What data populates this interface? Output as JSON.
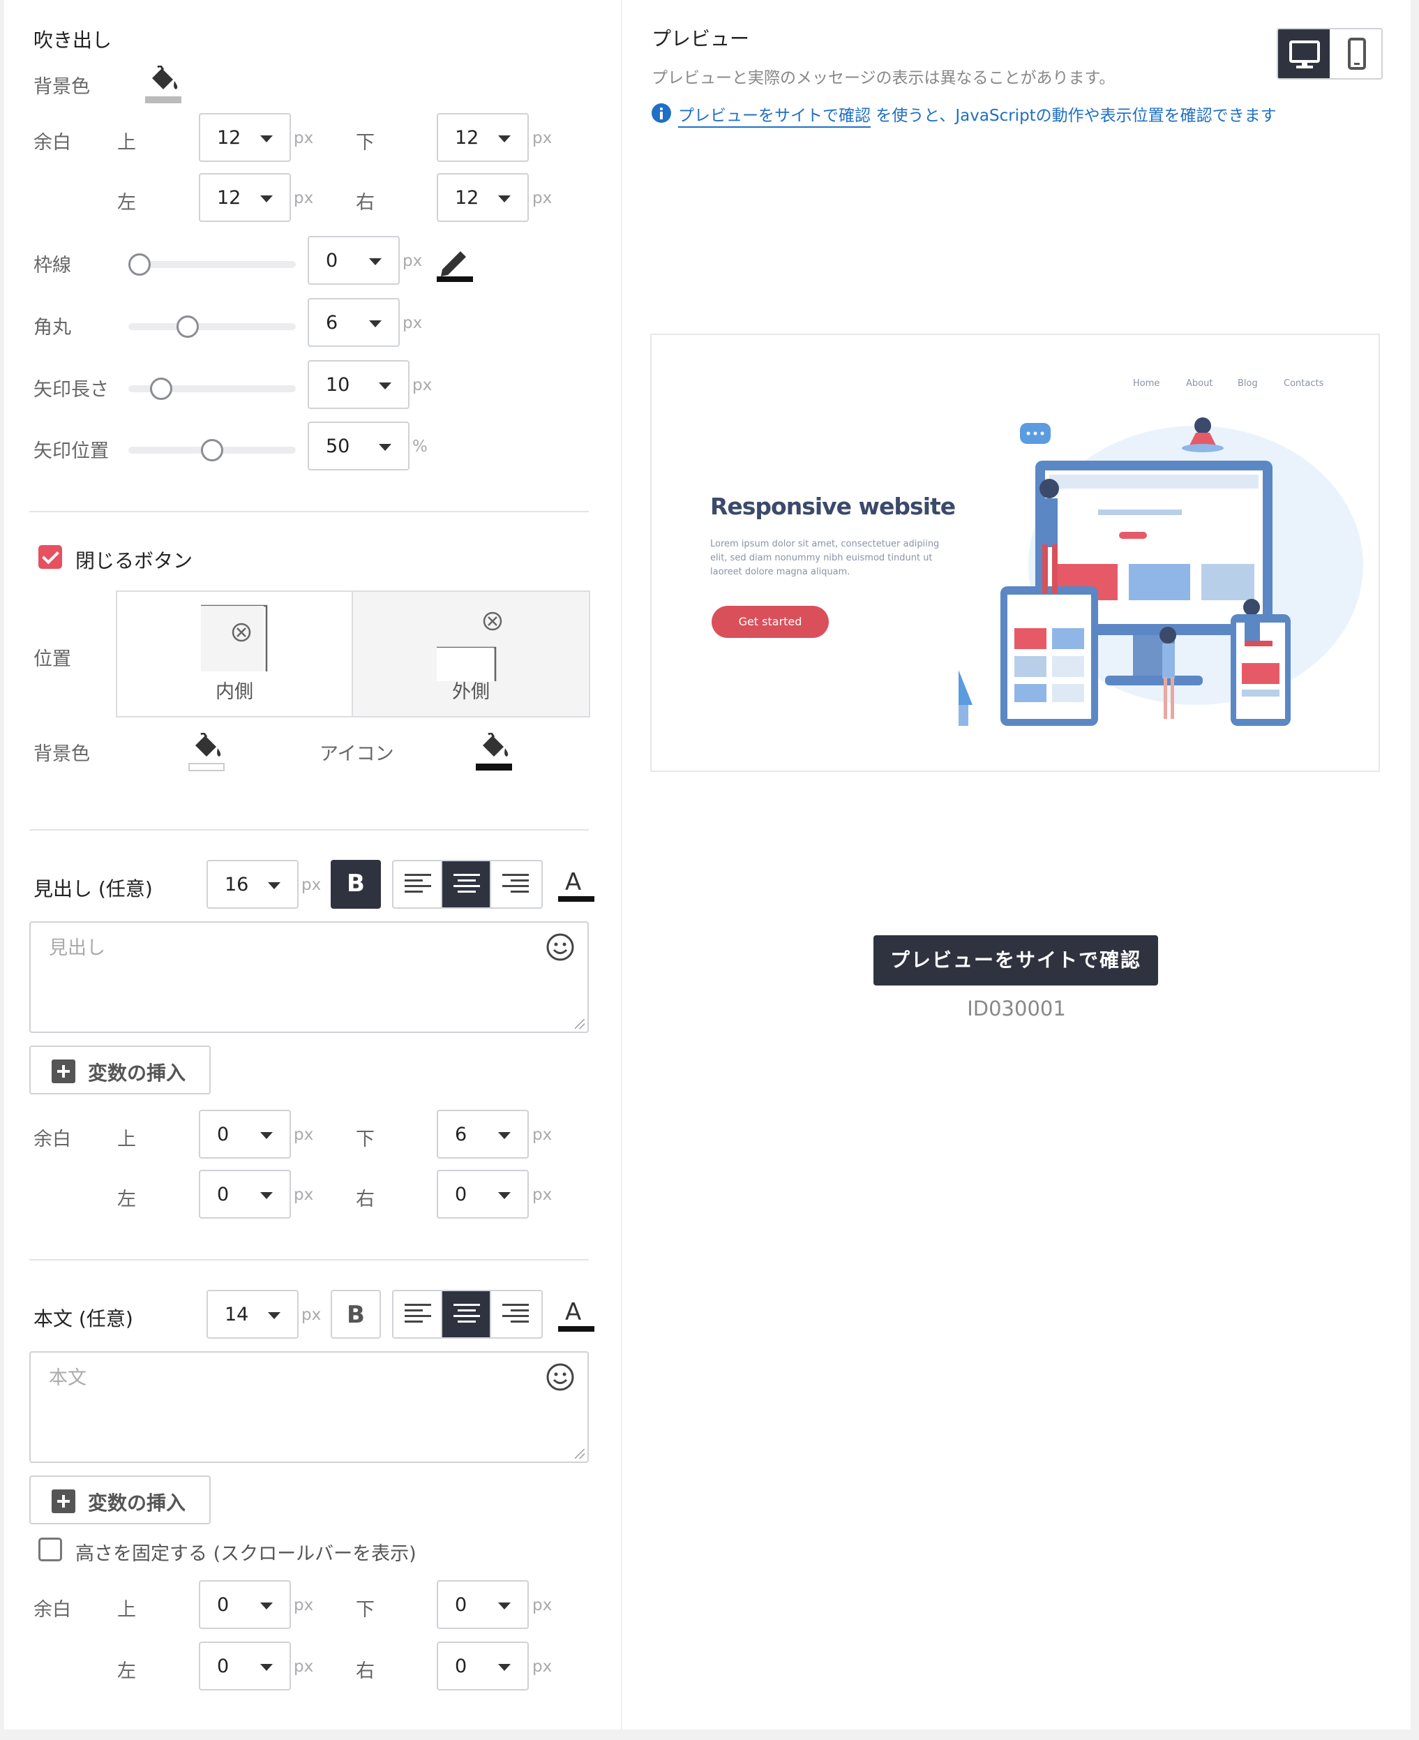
{
  "left": {
    "balloon": {
      "title": "吹き出し",
      "bg_label": "背景色",
      "padding": {
        "label": "余白",
        "top_label": "上",
        "bottom_label": "下",
        "left_label": "左",
        "right_label": "右",
        "top": "12",
        "bottom": "12",
        "left": "12",
        "right": "12",
        "unit": "px"
      },
      "border": {
        "label": "枠線",
        "value": "0",
        "unit": "px",
        "slider_fraction": 0.0
      },
      "radius": {
        "label": "角丸",
        "value": "6",
        "unit": "px",
        "slider_fraction": 0.33
      },
      "arrow_length": {
        "label": "矢印長さ",
        "value": "10",
        "unit": "px",
        "slider_fraction": 0.15
      },
      "arrow_position": {
        "label": "矢印位置",
        "value": "50",
        "unit": "%",
        "slider_fraction": 0.5
      }
    },
    "close_button": {
      "label": "閉じるボタン",
      "checked": true,
      "position_label": "位置",
      "inner_label": "内側",
      "outer_label": "外側",
      "bg_label": "背景色",
      "icon_label": "アイコン"
    },
    "heading": {
      "label": "見出し (任意)",
      "font_size": "16",
      "unit": "px",
      "bold_label": "B",
      "color_glyph": "A",
      "placeholder": "見出し",
      "insert_var": "変数の挿入",
      "padding": {
        "label": "余白",
        "top_label": "上",
        "bottom_label": "下",
        "left_label": "左",
        "right_label": "右",
        "top": "0",
        "bottom": "6",
        "left": "0",
        "right": "0",
        "unit": "px"
      }
    },
    "body": {
      "label": "本文 (任意)",
      "font_size": "14",
      "unit": "px",
      "bold_label": "B",
      "color_glyph": "A",
      "placeholder": "本文",
      "insert_var": "変数の挿入",
      "fix_height_label": "高さを固定する (スクロールバーを表示)",
      "fix_height_checked": false,
      "padding": {
        "label": "余白",
        "top_label": "上",
        "bottom_label": "下",
        "left_label": "左",
        "right_label": "右",
        "top": "0",
        "bottom": "0",
        "left": "0",
        "right": "0",
        "unit": "px"
      }
    }
  },
  "right": {
    "title": "プレビュー",
    "note": "プレビューと実際のメッセージの表示は異なることがあります。",
    "info_link": "プレビューをサイトで確認",
    "info_rest": " を使うと、JavaScriptの動作や表示位置を確認できます",
    "preview": {
      "nav": [
        "Home",
        "About",
        "Blog",
        "Contacts"
      ],
      "hero_title": "Responsive website",
      "hero_text_1": "Lorem ipsum dolor sit amet, consectetuer adipiing",
      "hero_text_2": "elit, sed diam nonummy nibh euismod tindunt ut",
      "hero_text_3": "laoreet dolore magna aliquam.",
      "hero_button": "Get started"
    },
    "cta_button": "プレビューをサイトで確認",
    "id_text": "ID030001"
  },
  "colors": {
    "accent_dark": "#2f3340",
    "checkbox_red": "#e7505f",
    "link_blue": "#1f6fc5",
    "preview_title": "#3b4a6b",
    "preview_button": "#d9505a"
  }
}
